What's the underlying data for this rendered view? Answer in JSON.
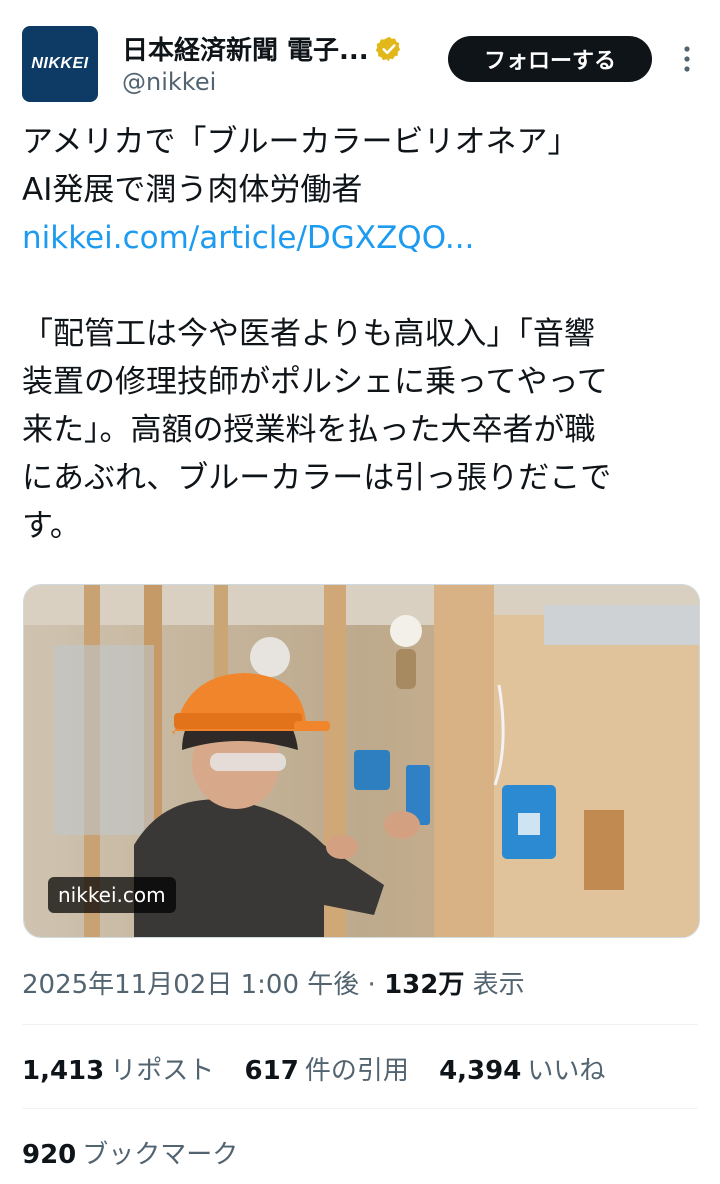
{
  "account": {
    "avatar_text": "NIKKEI",
    "display_name": "日本経済新聞 電子...",
    "handle": "@nikkei",
    "follow_label": "フォローする"
  },
  "tweet": {
    "line1": "アメリカで「ブルーカラービリオネア」",
    "line2": "AI発展で潤う肉体労働者",
    "link": "nikkei.com/article/DGXZQO...",
    "body_line1": "「配管工は今や医者よりも高収入」「音響",
    "body_line2": "装置の修理技師がポルシェに乗ってやって",
    "body_line3": "来た」。高額の授業料を払った大卒者が職",
    "body_line4": "にあぶれ、ブルーカラーは引っ張りだこで",
    "body_line5": "す。"
  },
  "media": {
    "badge": "nikkei.com"
  },
  "meta": {
    "date": "2025年11月02日 1:00 午後",
    "separator": " · ",
    "views_count": "132万",
    "views_label": "表示"
  },
  "stats": {
    "reposts_count": "1,413",
    "reposts_label": "リポスト",
    "quotes_count": "617",
    "quotes_label": "件の引用",
    "likes_count": "4,394",
    "likes_label": "いいね",
    "bookmarks_count": "920",
    "bookmarks_label": "ブックマーク"
  },
  "colors": {
    "accent": "#1d9bf0",
    "verified": "#e2b719",
    "avatar_bg": "#0e3a66",
    "text_secondary": "#536471"
  }
}
